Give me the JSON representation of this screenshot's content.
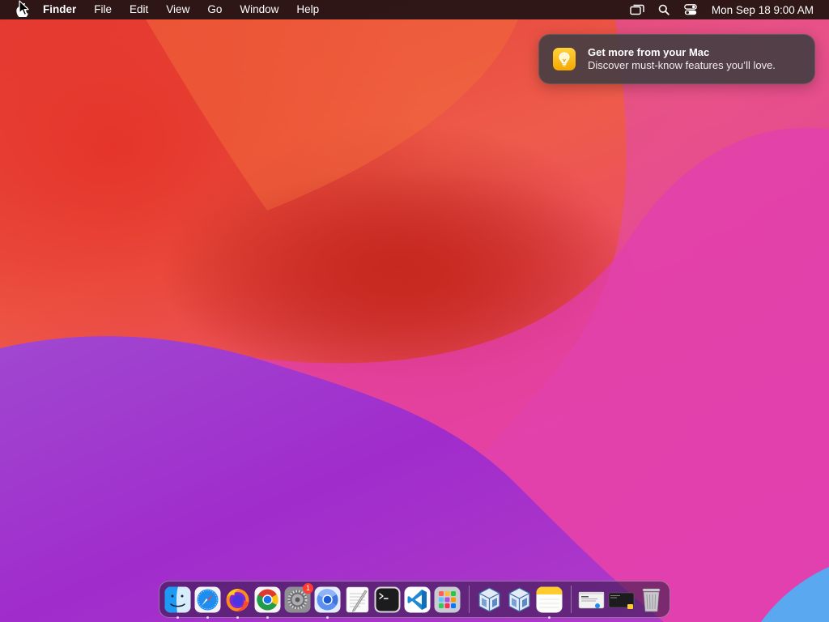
{
  "menubar": {
    "apple_icon": "apple-logo-icon",
    "app_name": "Finder",
    "items": [
      {
        "label": "File"
      },
      {
        "label": "Edit"
      },
      {
        "label": "View"
      },
      {
        "label": "Go"
      },
      {
        "label": "Window"
      },
      {
        "label": "Help"
      }
    ],
    "status_icons": [
      "screen-mirroring-icon",
      "spotlight-search-icon",
      "control-center-icon"
    ],
    "clock": "Mon Sep 18  9:00 AM"
  },
  "notification": {
    "icon": "lightbulb-icon",
    "title": "Get more from your Mac",
    "body": "Discover must-know features you’ll love."
  },
  "dock": {
    "items": [
      {
        "name": "finder",
        "icon": "finder-icon",
        "running": true
      },
      {
        "name": "safari",
        "icon": "safari-icon",
        "running": true
      },
      {
        "name": "firefox",
        "icon": "firefox-icon",
        "running": true
      },
      {
        "name": "chrome",
        "icon": "chrome-icon",
        "running": true
      },
      {
        "name": "system-settings",
        "icon": "gear-icon",
        "running": false,
        "badge": "1"
      },
      {
        "name": "chromium",
        "icon": "chromium-icon",
        "running": true
      },
      {
        "name": "textedit",
        "icon": "textedit-icon",
        "running": false
      },
      {
        "name": "terminal",
        "icon": "terminal-icon",
        "running": false
      },
      {
        "name": "vscode",
        "icon": "vscode-icon",
        "running": false
      },
      {
        "name": "launchpad",
        "icon": "launchpad-icon",
        "running": false
      },
      {
        "name": "virtualbox-1",
        "icon": "virtualbox-icon",
        "running": false
      },
      {
        "name": "virtualbox-2",
        "icon": "virtualbox-icon",
        "running": false
      },
      {
        "name": "notes",
        "icon": "notes-icon",
        "running": true
      },
      {
        "name": "recent-window-1",
        "icon": "window-thumbnail-icon",
        "running": false
      },
      {
        "name": "recent-window-2",
        "icon": "window-thumbnail-icon",
        "running": false
      },
      {
        "name": "trash",
        "icon": "trash-icon",
        "running": false
      }
    ]
  },
  "colors": {
    "menubar_bg": "#1e1214",
    "notification_bg": "#463e42",
    "accent_wallpaper_red": "#e23a34",
    "accent_wallpaper_magenta": "#e84ab8",
    "accent_wallpaper_purple": "#8a35c8",
    "badge_red": "#ff3b30"
  }
}
